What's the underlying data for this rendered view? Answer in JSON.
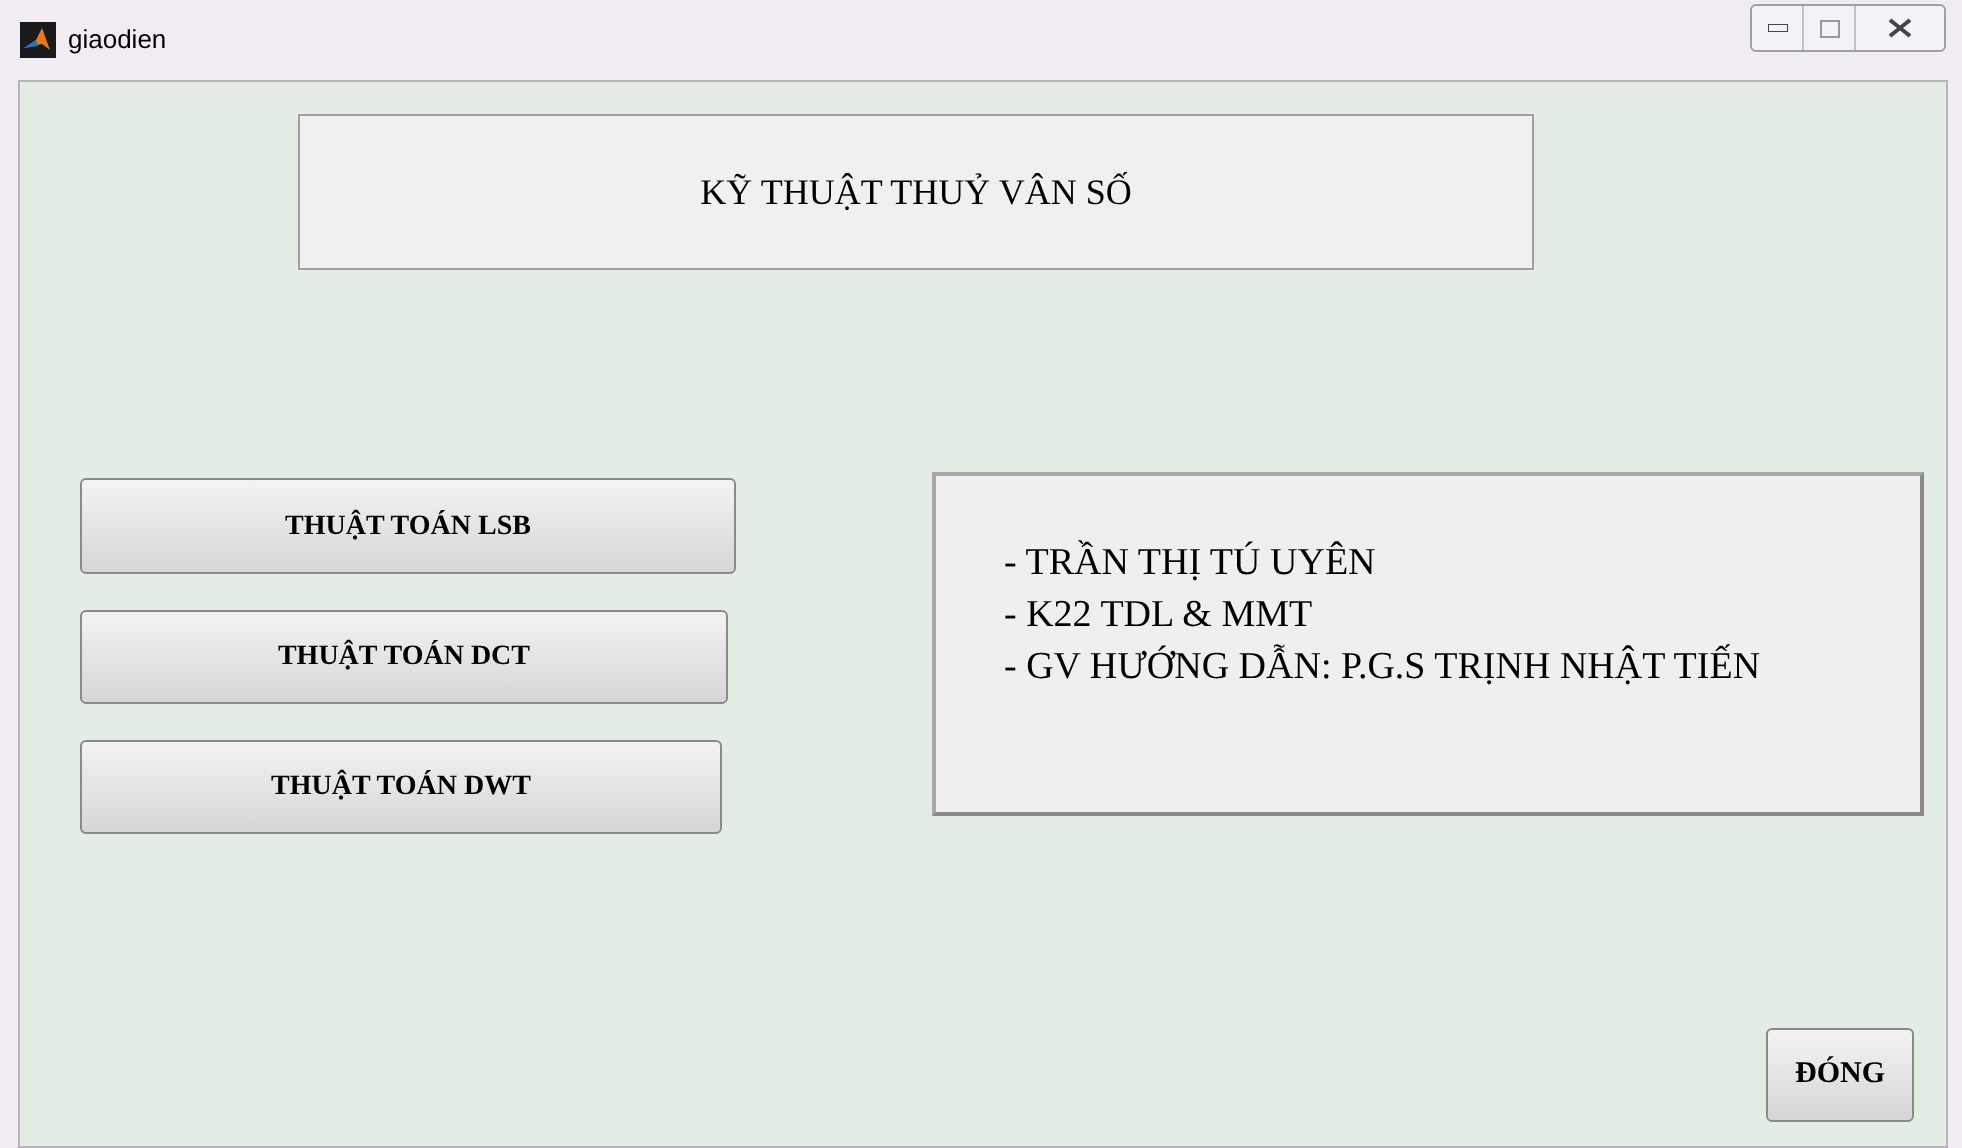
{
  "window": {
    "title": "giaodien"
  },
  "heading": "KỸ THUẬT THUỶ VÂN SỐ",
  "buttons": [
    {
      "label": "THUẬT TOÁN LSB"
    },
    {
      "label": "THUẬT TOÁN DCT"
    },
    {
      "label": "THUẬT TOÁN DWT"
    }
  ],
  "info_lines": [
    "- TRẦN THỊ TÚ UYÊN",
    "- K22 TDL & MMT",
    "- GV HƯỚNG DẪN: P.G.S TRỊNH NHẬT TIẾN"
  ],
  "close_button": {
    "label": "ĐÓNG"
  }
}
